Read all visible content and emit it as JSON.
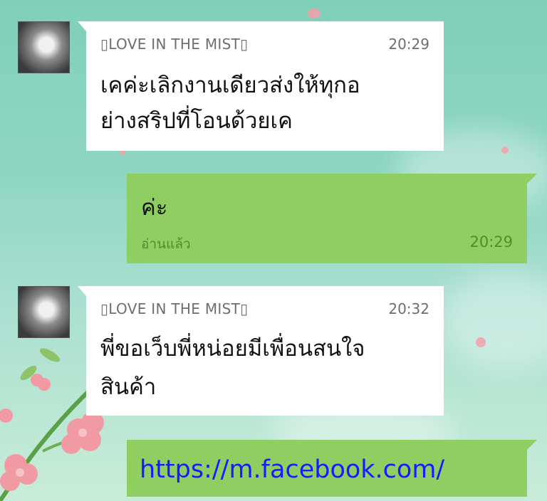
{
  "messages": [
    {
      "direction": "incoming",
      "sender": "▯LOVE IN THE MIST▯",
      "time": "20:29",
      "text_line1": "เคค่ะเลิกงานเดียวส่งให้ทุกอ",
      "text_line2": "ย่างสริปที่โอนด้วยเค"
    },
    {
      "direction": "outgoing",
      "text": "ค่ะ",
      "read_label": "อ่านแล้ว",
      "time": "20:29"
    },
    {
      "direction": "incoming",
      "sender": "▯LOVE IN THE MIST▯",
      "time": "20:32",
      "text_line1": "พี่ขอเว็บพี่หน่อยมีเพื่อนสนใจ",
      "text_line2": "สินค้า"
    },
    {
      "direction": "outgoing",
      "link_text": "https://m.facebook.com/"
    }
  ],
  "colors": {
    "incoming_bubble": "#ffffff",
    "outgoing_bubble": "#8fcf62",
    "link": "#1a1aff"
  }
}
